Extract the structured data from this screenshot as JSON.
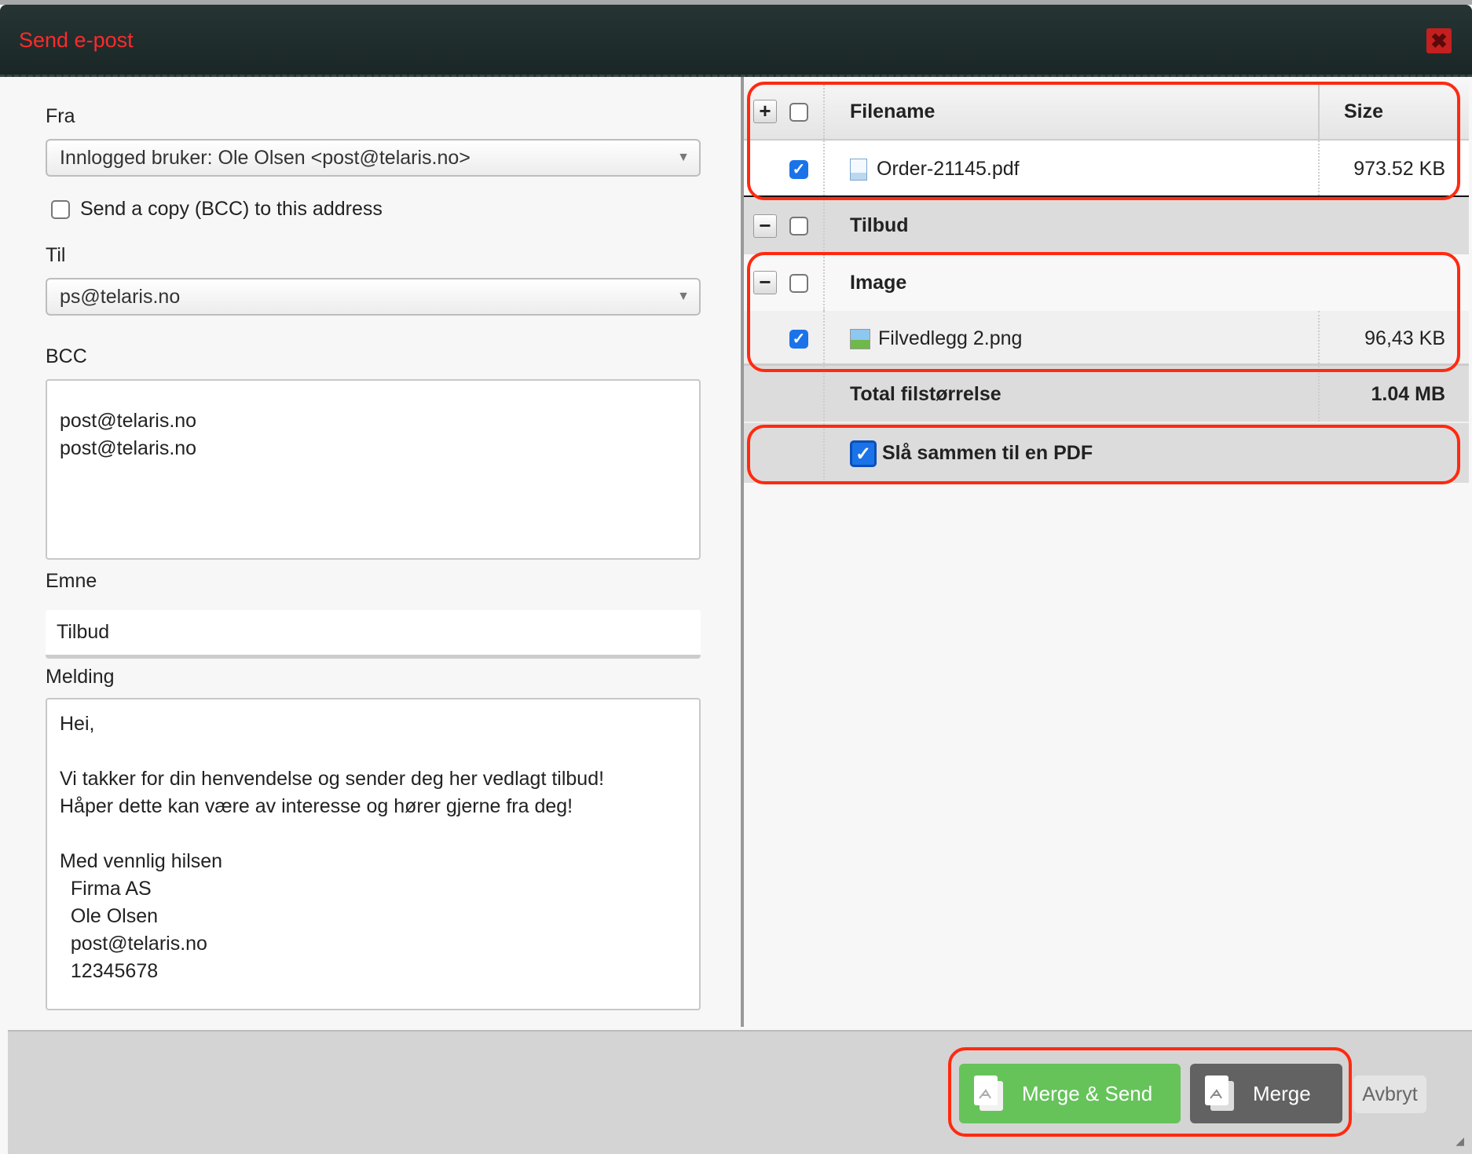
{
  "dialog": {
    "title": "Send e-post",
    "close_icon": "close-icon"
  },
  "form": {
    "from_label": "Fra",
    "from_value": "Innlogged bruker: Ole Olsen <post@telaris.no>",
    "bcc_copy_label": "Send a copy (BCC) to this address",
    "bcc_copy_checked": false,
    "to_label": "Til",
    "to_value": "ps@telaris.no",
    "bcc_label": "BCC",
    "bcc_value": "post@telaris.no\npost@telaris.no",
    "subject_label": "Emne",
    "subject_value": "Tilbud",
    "message_label": "Melding",
    "message_value": "Hei,\n\nVi takker for din henvendelse og sender deg her vedlagt tilbud!\nHåper dette kan være av interesse og hører gjerne fra deg!\n\nMed vennlig hilsen\n  Firma AS\n  Ole Olsen\n  post@telaris.no\n  12345678"
  },
  "attachments": {
    "col_filename": "Filename",
    "col_size": "Size",
    "files": [
      {
        "name": "Order-21145.pdf",
        "size": "973.52 KB",
        "checked": true
      }
    ],
    "groups": [
      {
        "name": "Tilbud"
      },
      {
        "name": "Image",
        "files": [
          {
            "name": "Filvedlegg 2.png",
            "size": "96,43 KB",
            "checked": true
          }
        ]
      }
    ],
    "total_label": "Total filstørrelse",
    "total_value": "1.04 MB",
    "merge_label": "Slå sammen til en PDF",
    "merge_checked": true
  },
  "footer": {
    "merge_send": "Merge & Send",
    "merge": "Merge",
    "cancel": "Avbryt"
  },
  "colors": {
    "title": "#ff2a2a",
    "merge_send": "#66c35a",
    "merge": "#626262",
    "highlight": "#ff2a10"
  }
}
